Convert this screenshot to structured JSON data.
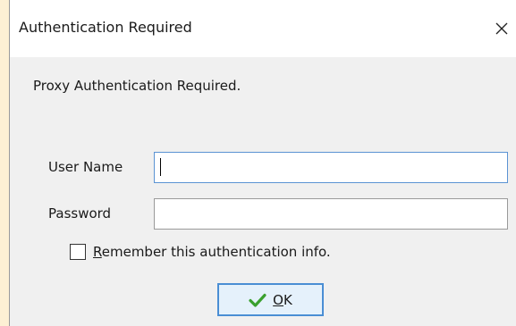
{
  "window": {
    "title": "Authentication Required",
    "close_icon": "close-icon"
  },
  "message": "Proxy Authentication Required.",
  "form": {
    "username_label": "User Name",
    "username_value": "",
    "password_label": "Password",
    "password_value": "",
    "remember": {
      "checked": false,
      "mnemonic": "R",
      "label_rest": "emember this authentication info."
    }
  },
  "ok_button": {
    "icon": "checkmark-icon",
    "mnemonic": "O",
    "label_rest": "K"
  },
  "colors": {
    "background": "#fdf0d4",
    "dialog_body": "#f0f0f0",
    "titlebar": "#ffffff",
    "focus_border": "#5b93d3",
    "button_fill": "#e5f1fb",
    "checkmark_green": "#3aa02e"
  }
}
